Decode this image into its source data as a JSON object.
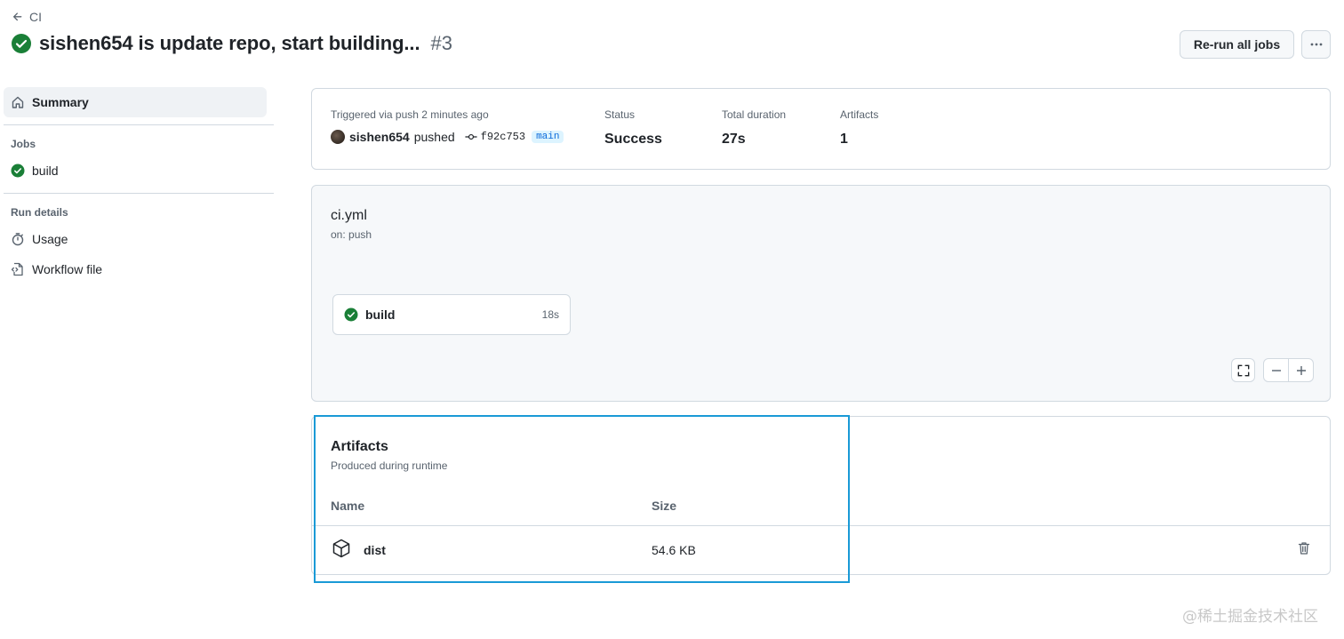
{
  "header": {
    "back_label": "CI",
    "run_title": "sishen654 is update repo, start building...",
    "run_number": "#3",
    "rerun_label": "Re-run all jobs"
  },
  "sidebar": {
    "summary_label": "Summary",
    "jobs_heading": "Jobs",
    "jobs": [
      {
        "label": "build",
        "status": "success"
      }
    ],
    "run_details_heading": "Run details",
    "usage_label": "Usage",
    "workflow_file_label": "Workflow file"
  },
  "summary": {
    "trigger_label": "Triggered via push 2 minutes ago",
    "actor": "sishen654",
    "action": "pushed",
    "commit": "f92c753",
    "branch": "main",
    "status_label": "Status",
    "status_value": "Success",
    "duration_label": "Total duration",
    "duration_value": "27s",
    "artifacts_label": "Artifacts",
    "artifacts_value": "1"
  },
  "workflow": {
    "file": "ci.yml",
    "trigger": "on: push",
    "job_name": "build",
    "job_duration": "18s"
  },
  "artifacts": {
    "title": "Artifacts",
    "subtitle": "Produced during runtime",
    "col_name": "Name",
    "col_size": "Size",
    "rows": [
      {
        "name": "dist",
        "size": "54.6 KB"
      }
    ]
  },
  "watermark": "@稀土掘金技术社区",
  "colors": {
    "success": "#1a7f37",
    "highlight": "#1a9ad6",
    "branch_bg": "#ddf4ff",
    "branch_fg": "#0969da"
  }
}
